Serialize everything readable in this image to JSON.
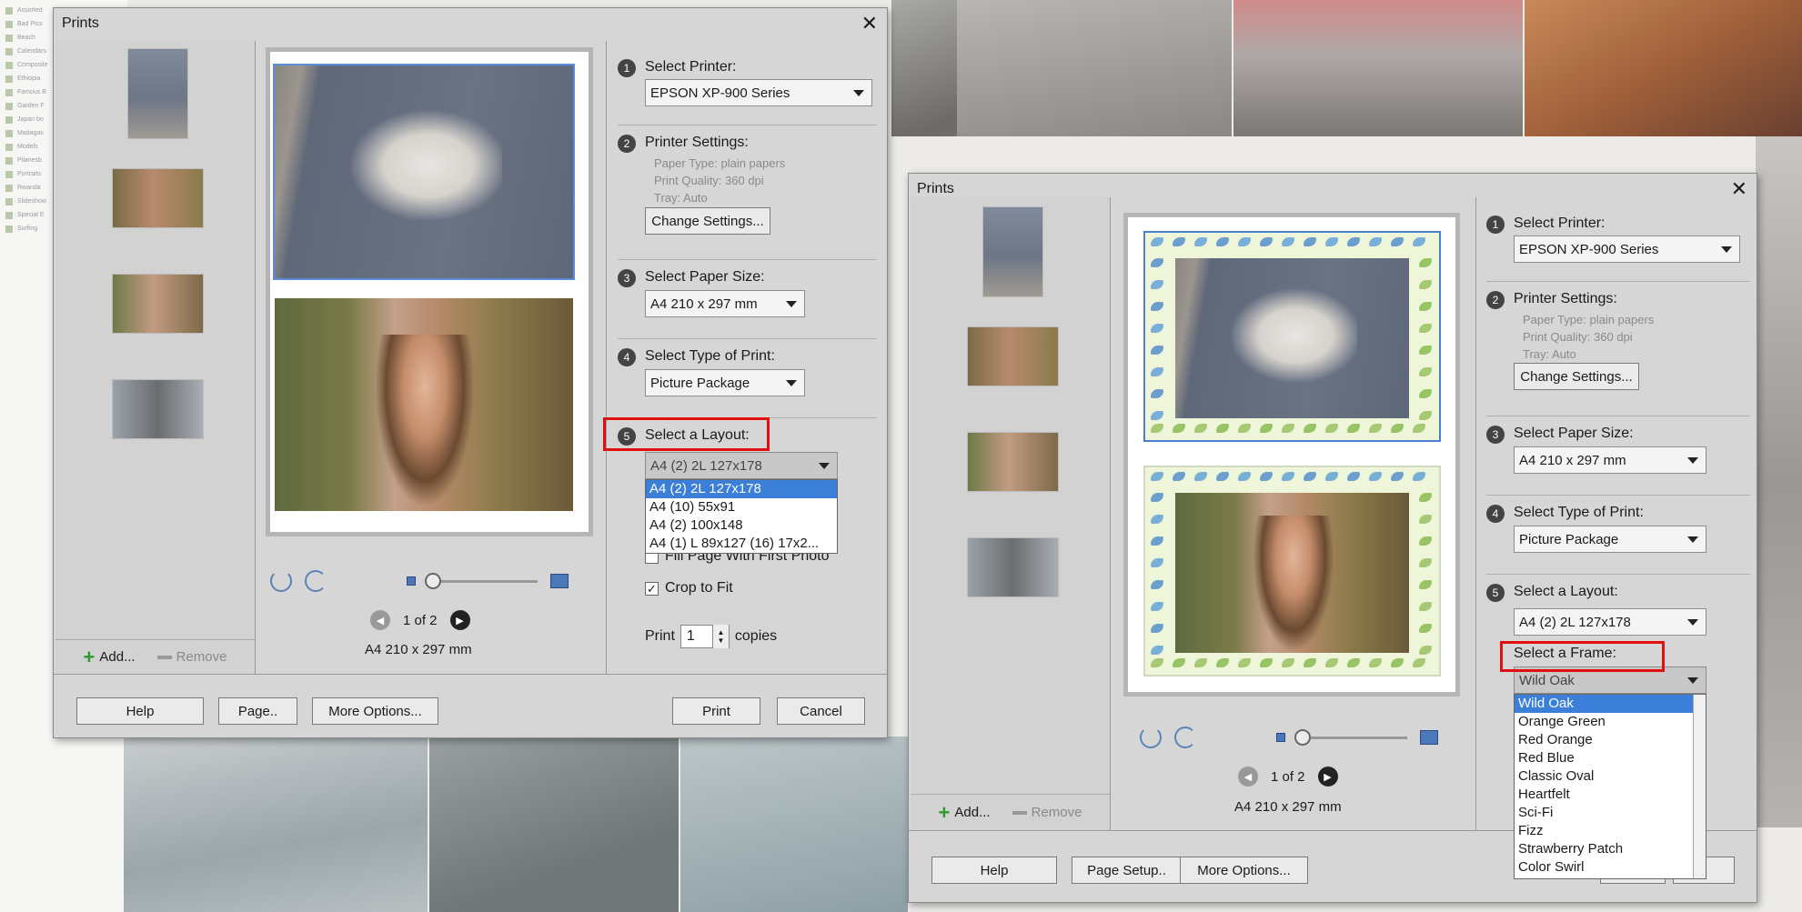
{
  "background": {
    "sidebar_items": [
      "Assorted",
      "Bad Pics",
      "Beach",
      "Calendars",
      "Composite",
      "Ethiopia",
      "Famous B",
      "Garden F",
      "Japan bo",
      "Madagas",
      "Models",
      "Pilanesb",
      "Portraits",
      "Rwanda",
      "Slideshow",
      "Special E",
      "Surfing"
    ]
  },
  "dialog1": {
    "title": "Prints",
    "add_label": "Add...",
    "remove_label": "Remove",
    "page_indicator": "1 of 2",
    "paper_size_text": "A4 210 x 297 mm",
    "steps": {
      "printer_label": "Select Printer:",
      "printer_value": "EPSON XP-900 Series",
      "settings_label": "Printer Settings:",
      "paper_type": "Paper Type: plain papers",
      "print_quality": "Print Quality: 360 dpi",
      "tray": "Tray: Auto",
      "change_settings": "Change Settings...",
      "paper_label": "Select Paper Size:",
      "paper_value": "A4 210 x 297 mm",
      "type_label": "Select Type of Print:",
      "type_value": "Picture Package",
      "layout_label": "Select a Layout:",
      "layout_value": "A4 (2) 2L 127x178"
    },
    "layout_options": [
      "A4 (2) 2L 127x178",
      "A4 (10) 55x91",
      "A4 (2) 100x148",
      "A4 (1) L 89x127 (16) 17x2..."
    ],
    "fill_page": "Fill Page With First Photo",
    "crop_to_fit": "Crop to Fit",
    "print_label": "Print",
    "copies_value": "1",
    "copies_label": "copies",
    "buttons": {
      "help": "Help",
      "page": "Page..",
      "more": "More Options...",
      "print": "Print",
      "cancel": "Cancel"
    }
  },
  "dialog2": {
    "title": "Prints",
    "add_label": "Add...",
    "remove_label": "Remove",
    "page_indicator": "1 of 2",
    "paper_size_text": "A4 210 x 297 mm",
    "steps": {
      "printer_label": "Select Printer:",
      "printer_value": "EPSON XP-900 Series",
      "settings_label": "Printer Settings:",
      "paper_type": "Paper Type: plain papers",
      "print_quality": "Print Quality: 360 dpi",
      "tray": "Tray: Auto",
      "change_settings": "Change Settings...",
      "paper_label": "Select Paper Size:",
      "paper_value": "A4 210 x 297 mm",
      "type_label": "Select Type of Print:",
      "type_value": "Picture Package",
      "layout_label": "Select a Layout:",
      "layout_value": "A4 (2) 2L 127x178",
      "frame_label": "Select a Frame:",
      "frame_value": "Wild Oak"
    },
    "frame_options": [
      "Wild Oak",
      "Orange Green",
      "Red Orange",
      "Red Blue",
      "Classic Oval",
      "Heartfelt",
      "Sci-Fi",
      "Fizz",
      "Strawberry Patch",
      "Color Swirl"
    ],
    "buttons": {
      "help": "Help",
      "page": "Page Setup..",
      "more": "More Options..."
    }
  },
  "step_numbers": [
    "1",
    "2",
    "3",
    "4",
    "5"
  ],
  "colors": {
    "accent": "#3b7fd9",
    "highlight": "#e01010",
    "dialog_bg": "#d6d6d6"
  }
}
